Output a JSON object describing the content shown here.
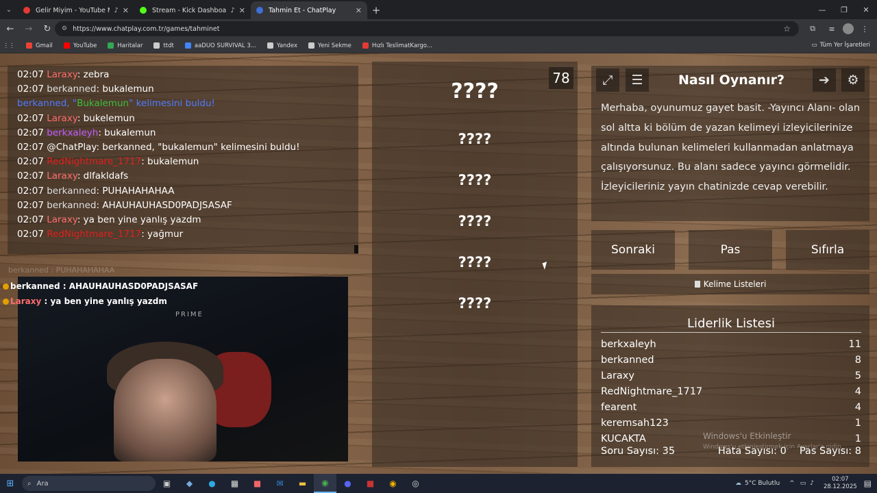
{
  "browser": {
    "tabs": [
      {
        "title": "Gelir Miyim - YouTube Music",
        "favicon_color": "#e53935",
        "active": false,
        "has_audio": true
      },
      {
        "title": "Stream - Kick Dashboard",
        "favicon_color": "#53fc18",
        "active": false,
        "has_audio": true
      },
      {
        "title": "Tahmin Et - ChatPlay",
        "favicon_color": "#3f6fd8",
        "active": true,
        "has_audio": false
      }
    ],
    "url": "https://www.chatplay.com.tr/games/tahminet",
    "bookmarks": [
      {
        "label": "Gmail",
        "color": "#ea4335"
      },
      {
        "label": "YouTube",
        "color": "#ff0000"
      },
      {
        "label": "Haritalar",
        "color": "#34a853"
      },
      {
        "label": "ttdt",
        "color": "#cccccc"
      },
      {
        "label": "aaDUO SURVIVAL 3...",
        "color": "#4285f4"
      },
      {
        "label": "Yandex",
        "color": "#cccccc"
      },
      {
        "label": "Yeni Sekme",
        "color": "#cccccc"
      },
      {
        "label": "Hızlı TeslimatKargo...",
        "color": "#e53935"
      }
    ],
    "all_bookmarks": "Tüm Yer İşaretleri"
  },
  "chat": {
    "messages": [
      {
        "time": "02:07",
        "user": "Laraxy",
        "user_color": "#ff6e6e",
        "text": ": zebra"
      },
      {
        "time": "02:07",
        "user": "berkanned",
        "user_color": "#e0e0e0",
        "text": ": bukalemun"
      },
      {
        "time": "",
        "user": "berkanned, \"",
        "user_color": "#4f7bff",
        "highlight": "Bukalemun",
        "highlight_color": "#3cbf3c",
        "text": "\" kelimesini buldu!",
        "text_color": "#4f7bff"
      },
      {
        "time": "02:07",
        "user": "Laraxy",
        "user_color": "#ff6e6e",
        "text": ": bukelemun"
      },
      {
        "time": "02:07",
        "user": "berkxaleyh",
        "user_color": "#c35cff",
        "text": ": bukalemun"
      },
      {
        "time": "02:07",
        "user": "@ChatPlay",
        "user_color": "#ffffff",
        "text": ": berkanned, \"bukalemun\" kelimesini buldu!"
      },
      {
        "time": "02:07",
        "user": "RedNightmare_1717",
        "user_color": "#e02020",
        "text": ": bukalemun"
      },
      {
        "time": "02:07",
        "user": "Laraxy",
        "user_color": "#ff6e6e",
        "text": ": dlfakldafs"
      },
      {
        "time": "02:07",
        "user": "berkanned",
        "user_color": "#e0e0e0",
        "text": ": PUHAHAHAHAA"
      },
      {
        "time": "02:07",
        "user": "berkanned",
        "user_color": "#e0e0e0",
        "text": ": AHAUHAUHASD0PADJSASAF"
      },
      {
        "time": "02:07",
        "user": "Laraxy",
        "user_color": "#ff6e6e",
        "text": ": ya ben yine yanlış yazdm"
      },
      {
        "time": "02:07",
        "user": "RedNightmare_1717",
        "user_color": "#e02020",
        "text": ": yağmur"
      }
    ]
  },
  "stream_overlay": {
    "faint_line": "berkanned : PUHAHAHAHAA",
    "lines": [
      {
        "user": "berkanned",
        "user_color": "#ffffff",
        "text": " : AHAUHAUHASD0PADJSASAF"
      },
      {
        "user": "Laraxy",
        "user_color": "#ff6e6e",
        "text": " : ya ben yine yanlış yazdm"
      }
    ],
    "chair_brand": "PRIME"
  },
  "game": {
    "timer": "78",
    "words": [
      "????",
      "????",
      "????",
      "????",
      "????",
      "????"
    ]
  },
  "howto": {
    "title": "Nasıl Oynanır?",
    "text": "Merhaba, oyunumuz gayet basit. -Yayıncı Alanı- olan sol altta ki bölüm de yazan kelimeyi izleyicilerinize altında bulunan kelimeleri kullanmadan anlatmaya çalışıyorsunuz. Bu alanı sadece yayıncı görmelidir. İzleyicileriniz yayın chatinizde cevap verebilir.",
    "icons": [
      "fullscreen-icon",
      "notes-icon",
      "exit-icon",
      "settings-icon"
    ]
  },
  "actions": {
    "next": "Sonraki",
    "pass": "Pas",
    "reset": "Sıfırla",
    "word_lists": "Kelime Listeleri"
  },
  "leaderboard": {
    "title": "Liderlik Listesi",
    "rows": [
      {
        "name": "berkxaleyh",
        "score": "11"
      },
      {
        "name": "berkanned",
        "score": "8"
      },
      {
        "name": "Laraxy",
        "score": "5"
      },
      {
        "name": "RedNightmare_1717",
        "score": "4"
      },
      {
        "name": "fearent",
        "score": "4"
      },
      {
        "name": "keremsah123",
        "score": "1"
      },
      {
        "name": "KUCAKTA",
        "score": "1"
      }
    ],
    "question_count": "Soru Sayısı: 35",
    "error_count": "Hata Sayısı: 0",
    "pass_count": "Pas Sayısı: 8"
  },
  "windows_watermark": {
    "title": "Windows'u Etkinleştir",
    "subtitle": "Windows'u etkinleştirmek için Ayarlar'a gidin."
  },
  "taskbar": {
    "search_placeholder": "Ara",
    "weather": "5°C  Bulutlu",
    "time": "02:07",
    "date": "28.12.2025"
  }
}
